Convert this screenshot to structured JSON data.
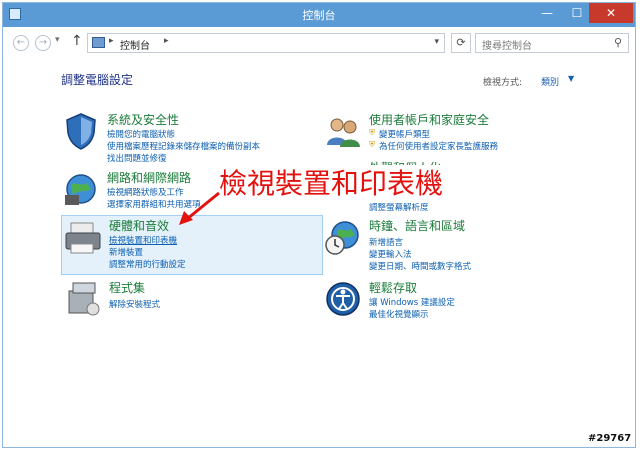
{
  "window": {
    "title": "控制台",
    "minimize_glyph": "—",
    "maximize_glyph": "☐",
    "close_glyph": "✕"
  },
  "address_bar": {
    "path": "控制台",
    "search_placeholder": "搜尋控制台"
  },
  "main": {
    "heading": "調整電腦設定",
    "view_by_label": "檢視方式:",
    "view_by_value": "類別"
  },
  "categories": {
    "system_security": {
      "title": "系統及安全性",
      "links": [
        "檢閱您的電腦狀態",
        "使用檔案歷程記錄來儲存檔案的備份副本",
        "找出問題並修復"
      ],
      "icon": "shield-icon"
    },
    "network_internet": {
      "title": "網路和網際網路",
      "links": [
        "檢視網路狀態及工作",
        "選擇家用群組和共用選項"
      ],
      "icon": "network-globe-icon"
    },
    "hardware_sound": {
      "title": "硬體和音效",
      "links": [
        "檢視裝置和印表機",
        "新增裝置",
        "調整常用的行動設定"
      ],
      "icon": "printer-icon"
    },
    "programs": {
      "title": "程式集",
      "links": [
        "解除安裝程式"
      ],
      "icon": "programs-box-icon"
    },
    "user_accounts": {
      "title": "使用者帳戶和家庭安全",
      "links": [
        "變更帳戶類型",
        "為任何使用者設定家長監護服務"
      ],
      "icon": "users-icon"
    },
    "appearance": {
      "title": "外觀和個人化",
      "links": [
        "調整螢幕解析度"
      ],
      "icon": "appearance-icon"
    },
    "clock_language_region": {
      "title": "時鐘、語言和區域",
      "links": [
        "新增語言",
        "變更輸入法",
        "變更日期、時間或數字格式"
      ],
      "icon": "clock-globe-icon"
    },
    "ease_of_access": {
      "title": "輕鬆存取",
      "links": [
        "讓 Windows 建議設定",
        "最佳化視覺顯示"
      ],
      "icon": "ease-of-access-icon"
    }
  },
  "annotation": {
    "callout_text": "檢視裝置和印表機",
    "color": "#e4120f"
  },
  "watermark": "#29767",
  "colors": {
    "titlebar": "#5b9bd5",
    "category_title": "#1c7c3a",
    "link": "#0c5fb2",
    "heading": "#1e3287",
    "highlight": "#e4f1fb"
  }
}
